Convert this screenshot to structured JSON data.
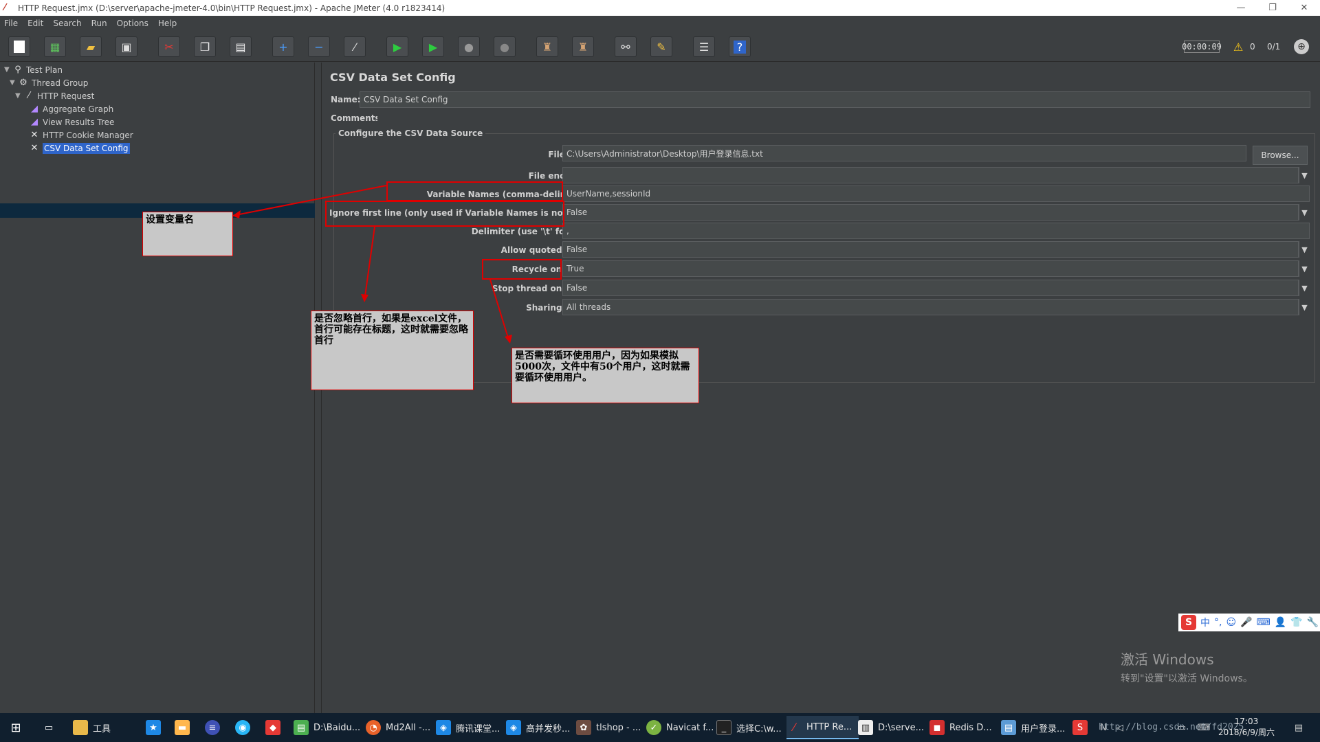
{
  "window": {
    "title": "HTTP Request.jmx (D:\\server\\apache-jmeter-4.0\\bin\\HTTP Request.jmx) - Apache JMeter (4.0 r1823414)",
    "controls": [
      "—",
      "❐",
      "✕"
    ]
  },
  "menu": [
    "File",
    "Edit",
    "Search",
    "Run",
    "Options",
    "Help"
  ],
  "status": {
    "timer": "00:00:09",
    "warnings": "0",
    "threads": "0/1"
  },
  "tree": {
    "items": [
      {
        "label": "Test Plan",
        "icon": "test-plan-icon"
      },
      {
        "label": "Thread Group",
        "icon": "gear-icon"
      },
      {
        "label": "HTTP Request",
        "icon": "pipette-icon"
      },
      {
        "label": "Aggregate Graph",
        "icon": "graph-icon"
      },
      {
        "label": "View Results Tree",
        "icon": "graph-icon"
      },
      {
        "label": "HTTP Cookie Manager",
        "icon": "tools-icon"
      },
      {
        "label": "CSV Data Set Config",
        "icon": "tools-icon"
      }
    ]
  },
  "config": {
    "title": "CSV Data Set Config",
    "name_label": "Name:",
    "name_value": "CSV Data Set Config",
    "comments_label": "Comments:",
    "group_title": "Configure the CSV Data Source",
    "filename_label": "Filename:",
    "filename_value": "C:\\Users\\Administrator\\Desktop\\用户登录信息.txt",
    "browse_label": "Browse...",
    "encoding_label": "File encoding:",
    "encoding_value": "",
    "varnames_label": "Variable Names (comma-delimited):",
    "varnames_value": "UserName,sessionId",
    "ignore_label": "Ignore first line (only used if Variable Names is not empty):",
    "ignore_value": "False",
    "delimiter_label": "Delimiter (use '\\t' for tab):",
    "delimiter_value": ",",
    "quoted_label": "Allow quoted data?:",
    "quoted_value": "False",
    "recycle_label": "Recycle on EOF ?:",
    "recycle_value": "True",
    "stop_label": "Stop thread on EOF ?:",
    "stop_value": "False",
    "sharing_label": "Sharing mode:",
    "sharing_value": "All threads"
  },
  "notes": {
    "varname": "设置变量名",
    "ignore": "是否忽略首行，如果是excel文件，首行可能存在标题，这时就需要忽略首行",
    "recycle": "是否需要循环使用用户，因为如果模拟5000次，文件中有50个用户，这时就需要循环使用用户。"
  },
  "watermark_activate": {
    "line1": "激活 Windows",
    "line2": "转到\"设置\"以激活 Windows。"
  },
  "ime": [
    "中",
    "°,",
    "☺",
    "🎤",
    "⌨",
    "👤",
    "👕",
    "🔧"
  ],
  "taskbar": {
    "items": [
      {
        "label": "工具",
        "icon": "folder-icon",
        "color": "#e8b84a"
      },
      {
        "label": "D:\\Baidu...",
        "icon": "notepad-icon",
        "color": "#4caf50"
      },
      {
        "label": "Md2All -...",
        "icon": "firefox-icon",
        "color": "#e8622a"
      },
      {
        "label": "腾讯课堂...",
        "icon": "tencent-icon",
        "color": "#1e88e5"
      },
      {
        "label": "高并发秒...",
        "icon": "tencent-icon",
        "color": "#1e88e5"
      },
      {
        "label": "tlshop - ...",
        "icon": "app-icon",
        "color": "#6d4c41"
      },
      {
        "label": "Navicat f...",
        "icon": "navicat-icon",
        "color": "#7cb342"
      },
      {
        "label": "选择C:\\w...",
        "icon": "cmd-icon",
        "color": "#222"
      },
      {
        "label": "HTTP Re...",
        "icon": "jmeter-icon",
        "color": "#c0392b"
      },
      {
        "label": "D:\\serve...",
        "icon": "explorer-icon",
        "color": "#eee"
      },
      {
        "label": "Redis D...",
        "icon": "redis-icon",
        "color": "#d32f2f"
      },
      {
        "label": "用户登录...",
        "icon": "notepad-icon",
        "color": "#5c9bd6"
      }
    ],
    "time": "17:03",
    "date": "2018/6/9/周六",
    "url_watermark": "http://blog.csdn.net/fd2025"
  }
}
